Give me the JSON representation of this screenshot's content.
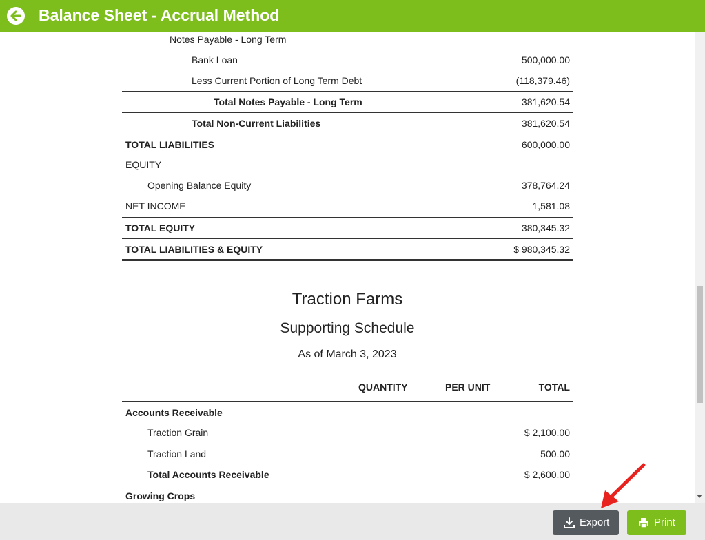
{
  "header": {
    "title": "Balance Sheet - Accrual Method",
    "back_icon": "arrow-left-circle-icon"
  },
  "balance_rows": [
    {
      "label": "Notes Payable - Long Term",
      "value": ""
    },
    {
      "label": "Bank Loan",
      "value": "500,000.00"
    },
    {
      "label": "Less Current Portion of Long Term Debt",
      "value": "(118,379.46)"
    },
    {
      "label": "Total Notes Payable - Long Term",
      "value": "381,620.54"
    },
    {
      "label": "Total Non-Current Liabilities",
      "value": "381,620.54"
    },
    {
      "label": "TOTAL LIABILITIES",
      "value": "600,000.00"
    },
    {
      "label": "EQUITY",
      "value": ""
    },
    {
      "label": "Opening Balance Equity",
      "value": "378,764.24"
    },
    {
      "label": "NET INCOME",
      "value": "1,581.08"
    },
    {
      "label": "TOTAL EQUITY",
      "value": "380,345.32"
    },
    {
      "label": "TOTAL LIABILITIES & EQUITY",
      "value": "$ 980,345.32"
    }
  ],
  "schedule": {
    "company": "Traction Farms",
    "title": "Supporting Schedule",
    "date": "As of March 3, 2023",
    "columns": [
      "QUANTITY",
      "PER UNIT",
      "TOTAL"
    ],
    "rows": [
      {
        "label": "Accounts Receivable",
        "total": ""
      },
      {
        "label": "Traction Grain",
        "total": "$ 2,100.00"
      },
      {
        "label": "Traction Land",
        "total": "500.00"
      },
      {
        "label": "Total Accounts Receivable",
        "total": "$ 2,600.00"
      },
      {
        "label": "Growing Crops",
        "total": ""
      }
    ]
  },
  "footer": {
    "export_label": "Export",
    "print_label": "Print",
    "export_icon": "download-icon",
    "print_icon": "printer-icon"
  },
  "colors": {
    "brand": "#7dbd1c",
    "export_button": "#555a5f",
    "annotation_arrow": "#e8231f"
  }
}
